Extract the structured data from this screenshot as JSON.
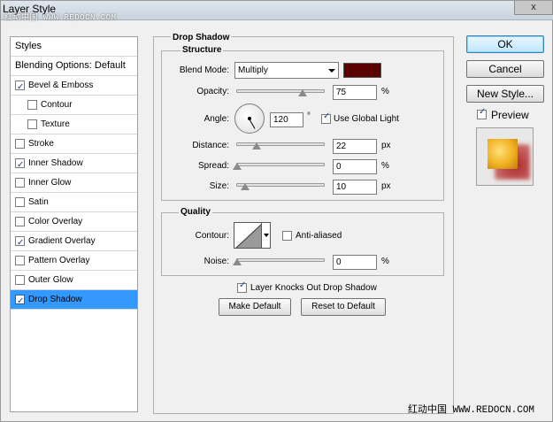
{
  "window": {
    "title": "Layer Style",
    "close_label": "x"
  },
  "watermark": {
    "top": "红动中国 WWW.REDOCN.COM",
    "bottom": "红动中国 WWW.REDOCN.COM"
  },
  "sidebar": {
    "items": [
      {
        "label": "Styles",
        "checked": null
      },
      {
        "label": "Blending Options: Default",
        "checked": null
      },
      {
        "label": "Bevel & Emboss",
        "checked": true
      },
      {
        "label": "Contour",
        "checked": false
      },
      {
        "label": "Texture",
        "checked": false
      },
      {
        "label": "Stroke",
        "checked": false
      },
      {
        "label": "Inner Shadow",
        "checked": true
      },
      {
        "label": "Inner Glow",
        "checked": false
      },
      {
        "label": "Satin",
        "checked": false
      },
      {
        "label": "Color Overlay",
        "checked": false
      },
      {
        "label": "Gradient Overlay",
        "checked": true
      },
      {
        "label": "Pattern Overlay",
        "checked": false
      },
      {
        "label": "Outer Glow",
        "checked": false
      },
      {
        "label": "Drop Shadow",
        "checked": true,
        "selected": true
      }
    ]
  },
  "drop_shadow": {
    "title": "Drop Shadow",
    "structure": {
      "title": "Structure",
      "blend_mode_label": "Blend Mode:",
      "blend_mode_value": "Multiply",
      "shadow_color": "#5a0000",
      "opacity_label": "Opacity:",
      "opacity_value": "75",
      "opacity_level": 0.75,
      "opacity_unit": "%",
      "angle_label": "Angle:",
      "angle_value": "120",
      "angle_unit": "°",
      "use_global_light_label": "Use Global Light",
      "use_global_light": true,
      "distance_label": "Distance:",
      "distance_value": "22",
      "distance_unit": "px",
      "spread_label": "Spread:",
      "spread_value": "0",
      "spread_unit": "%",
      "size_label": "Size:",
      "size_value": "10",
      "size_unit": "px"
    },
    "quality": {
      "title": "Quality",
      "contour_label": "Contour:",
      "anti_aliased_label": "Anti-aliased",
      "anti_aliased": false,
      "noise_label": "Noise:",
      "noise_value": "0",
      "noise_unit": "%"
    },
    "knockout_label": "Layer Knocks Out Drop Shadow",
    "knockout": true,
    "make_default_label": "Make Default",
    "reset_default_label": "Reset to Default"
  },
  "actions": {
    "ok_label": "OK",
    "cancel_label": "Cancel",
    "new_style_label": "New Style...",
    "preview_label": "Preview",
    "preview_checked": true
  }
}
